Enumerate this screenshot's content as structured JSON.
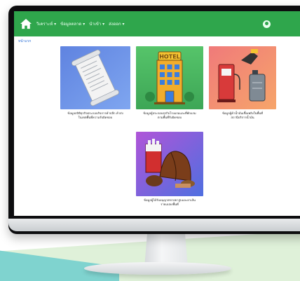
{
  "navbar": {
    "items": [
      {
        "label": "วิเคราะห์ ▾"
      },
      {
        "label": "ข้อมูลตลาด ▾"
      },
      {
        "label": "นำเข้า ▾"
      },
      {
        "label": "ส่งออก ▾"
      }
    ],
    "accent_color": "#2fa64c"
  },
  "breadcrumb": "หน้าแรก",
  "cards": [
    {
      "icon": "document-scroll-icon",
      "caption_line1": "ข้อมูลสถิติธุรกิจประกอบกิจการค้าปลีก ค้าส่ง",
      "caption_line2": "ในเขตพื้นที่ความรับผิดชอบ"
    },
    {
      "icon": "hotel-icon",
      "caption_line1": "ข้อมูลผู้ประกอบธุรกิจโรงแรมและที่พักแรม",
      "caption_line2": "ตามพื้นที่รับผิดชอบ"
    },
    {
      "icon": "fuel-pump-icon",
      "caption_line1": "ข้อมูลผู้ค้าน้ำมันเชื้อเพลิงในพื้นที่",
      "caption_line2": "สถานีบริการน้ำมัน"
    },
    {
      "icon": "tobacco-icon",
      "caption_line1": "ข้อมูลผู้ได้รับอนุญาตขายยาสูบและยาเส้น",
      "caption_line2": "รายแปลงพื้นที่"
    }
  ]
}
